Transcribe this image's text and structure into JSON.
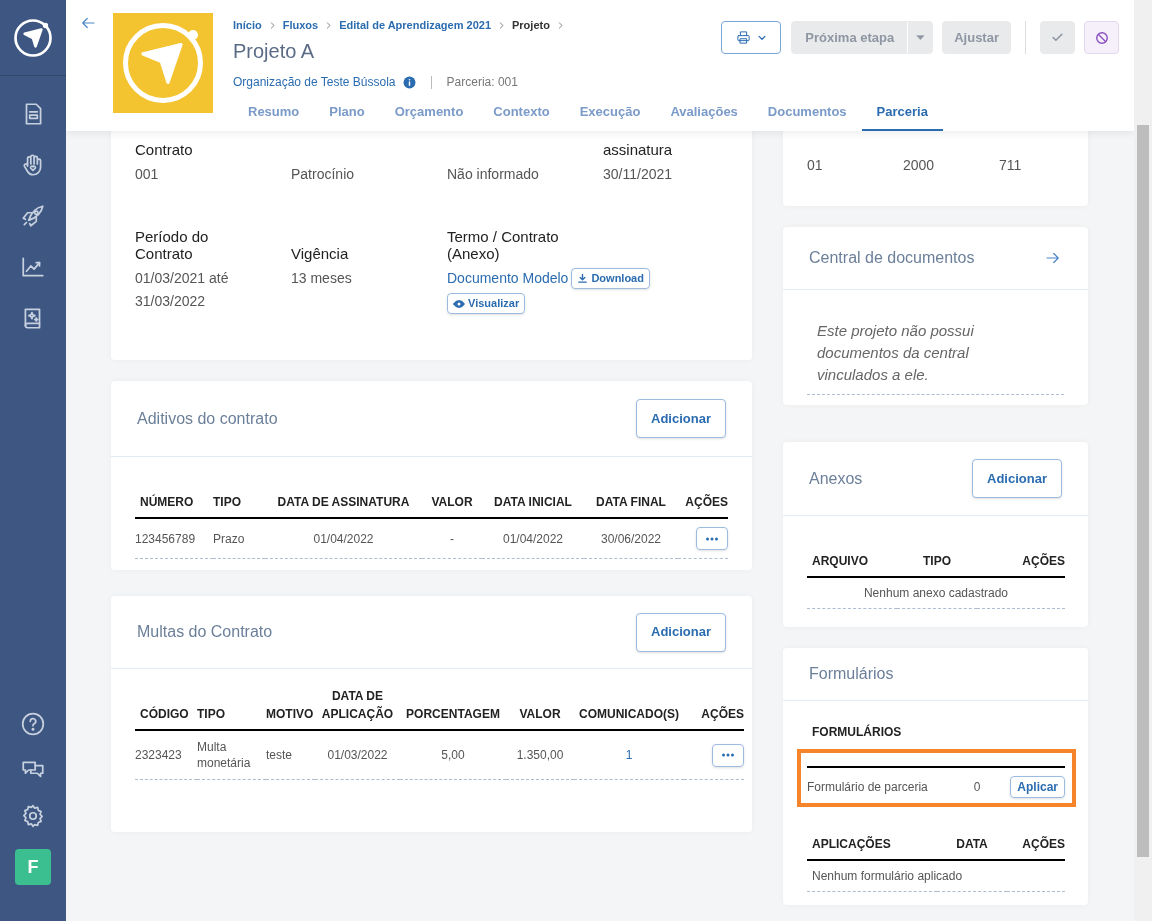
{
  "sidebar": {
    "avatar": "F"
  },
  "header": {
    "breadcrumb": [
      "Início",
      "Fluxos",
      "Edital de Aprendizagem 2021",
      "Projeto"
    ],
    "title": "Projeto A",
    "organization": "Organização de Teste Bússola",
    "partnership": "Parceria: 001",
    "tabs": [
      {
        "label": "Resumo",
        "selected": false
      },
      {
        "label": "Plano",
        "selected": false
      },
      {
        "label": "Orçamento",
        "selected": false
      },
      {
        "label": "Contexto",
        "selected": false
      },
      {
        "label": "Execução",
        "selected": false
      },
      {
        "label": "Avaliações",
        "selected": false
      },
      {
        "label": "Documentos",
        "selected": false
      },
      {
        "label": "Parceria",
        "selected": true
      }
    ],
    "actions": [
      {
        "kind": "print",
        "disabled": false
      },
      {
        "kind": "split",
        "label": "Próxima etapa",
        "disabled": true
      },
      {
        "kind": "text",
        "label": "Ajustar",
        "disabled": true
      },
      {
        "kind": "approve",
        "disabled": true
      },
      {
        "kind": "cancel",
        "disabled": false
      }
    ]
  },
  "contract": {
    "fields": [
      {
        "label": "Contrato",
        "value": "001"
      },
      {
        "value": "Patrocínio"
      },
      {
        "value": "Não informado"
      },
      {
        "label": "assinatura",
        "value": "30/11/2021"
      },
      {
        "label": "Período do Contrato",
        "value": "01/03/2021 até 31/03/2022"
      },
      {
        "label": "Vigência",
        "value": "13 meses"
      },
      {
        "label": "Termo / Contrato (Anexo)",
        "link": "Documento Modelo",
        "buttons": [
          "Download",
          "Visualizar"
        ]
      }
    ]
  },
  "amendments": {
    "title": "Aditivos do contrato",
    "button": "Adicionar",
    "table": {
      "columns": [
        {
          "label": "NÚMERO"
        },
        {
          "label": "TIPO"
        },
        {
          "label": "DATA DE ASSINATURA"
        },
        {
          "label": "VALOR"
        },
        {
          "label": "DATA INICIAL"
        },
        {
          "label": "DATA FINAL"
        },
        {
          "label": "AÇÕES",
          "kind": "actions"
        }
      ],
      "rows": [
        [
          "123456789",
          "Prazo",
          "01/04/2022",
          "-",
          "01/04/2022",
          "30/06/2022"
        ]
      ]
    }
  },
  "fines": {
    "title": "Multas do Contrato",
    "button": "Adicionar",
    "table": {
      "columns": [
        {
          "label": "CÓDIGO"
        },
        {
          "label": "TIPO"
        },
        {
          "label": "MOTIVO"
        },
        {
          "label": "DATA DE APLICAÇÃO"
        },
        {
          "label": "PORCENTAGEM"
        },
        {
          "label": "VALOR"
        },
        {
          "label": "COMUNICADO(S)",
          "kind": "link"
        },
        {
          "label": "AÇÕES",
          "kind": "actions"
        }
      ],
      "rows": [
        [
          "2323423",
          "Multa monetária",
          "teste",
          "01/03/2022",
          "5,00",
          "1.350,00",
          "1"
        ]
      ]
    }
  },
  "bank": {
    "fields": [
      {
        "value": "01"
      },
      {
        "value": "2000"
      },
      {
        "value": "711"
      }
    ]
  },
  "documents_center": {
    "title": "Central de documentos",
    "empty": "Este projeto não possui documentos da central vinculados a ele."
  },
  "attachments": {
    "title": "Anexos",
    "button": "Adicionar",
    "table": {
      "columns": [
        {
          "label": "ARQUIVO"
        },
        {
          "label": "TIPO"
        },
        {
          "label": "AÇÕES"
        }
      ],
      "empty": "Nenhum anexo cadastrado"
    }
  },
  "forms": {
    "title": "Formulários",
    "linked": {
      "columns": [
        {
          "label": "FORMULÁRIOS"
        },
        {},
        {
          "kind": "button"
        }
      ],
      "rows": [
        [
          "Formulário de parceria",
          "0",
          "Aplicar"
        ]
      ]
    },
    "applications": {
      "columns": [
        {
          "label": "APLICAÇÕES"
        },
        {
          "label": "DATA"
        },
        {
          "label": "AÇÕES"
        }
      ],
      "empty": "Nenhum formulário aplicado"
    }
  }
}
